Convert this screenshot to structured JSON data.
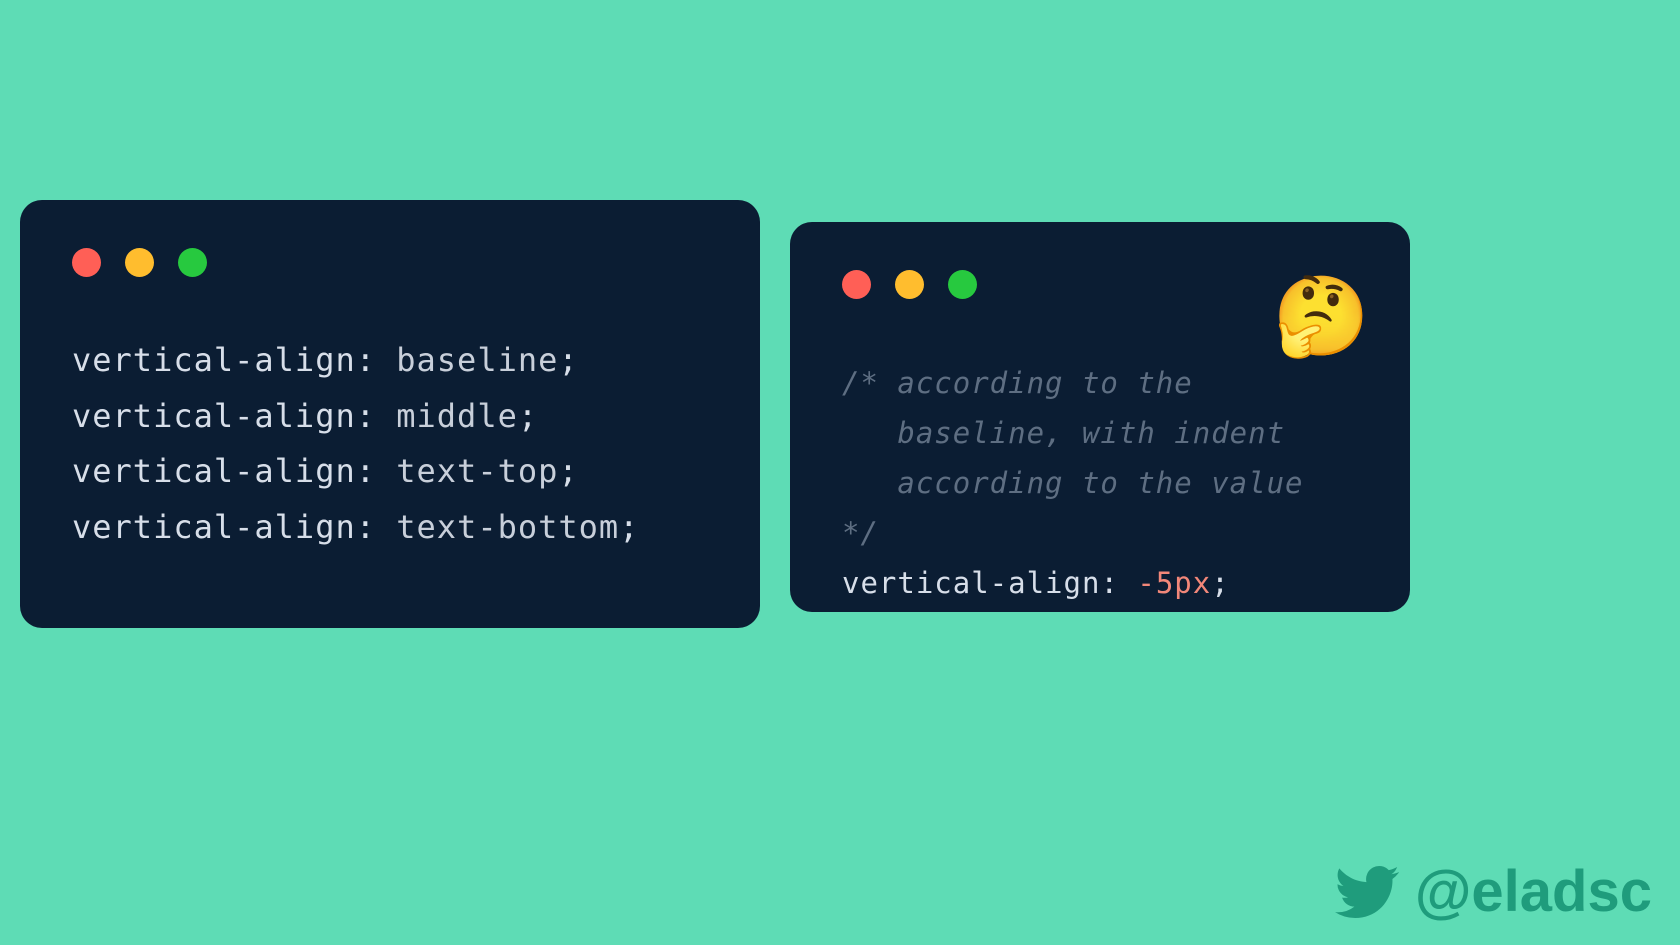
{
  "left": {
    "lines": [
      {
        "prop": "vertical-align",
        "val": "baseline"
      },
      {
        "prop": "vertical-align",
        "val": "middle"
      },
      {
        "prop": "vertical-align",
        "val": "text-top"
      },
      {
        "prop": "vertical-align",
        "val": "text-bottom"
      }
    ]
  },
  "right": {
    "comment_l1": "/* according to the",
    "comment_l2": "   baseline, with indent",
    "comment_l3": "   according to the value */",
    "prop": "vertical-align",
    "num": "-5px",
    "emoji": "🤔"
  },
  "attribution": {
    "handle": "@eladsc"
  },
  "colors": {
    "bg": "#5EDCB5",
    "window": "#0B1D33",
    "red": "#FF5F56",
    "yellow": "#FFBD2E",
    "green": "#27C93F"
  }
}
